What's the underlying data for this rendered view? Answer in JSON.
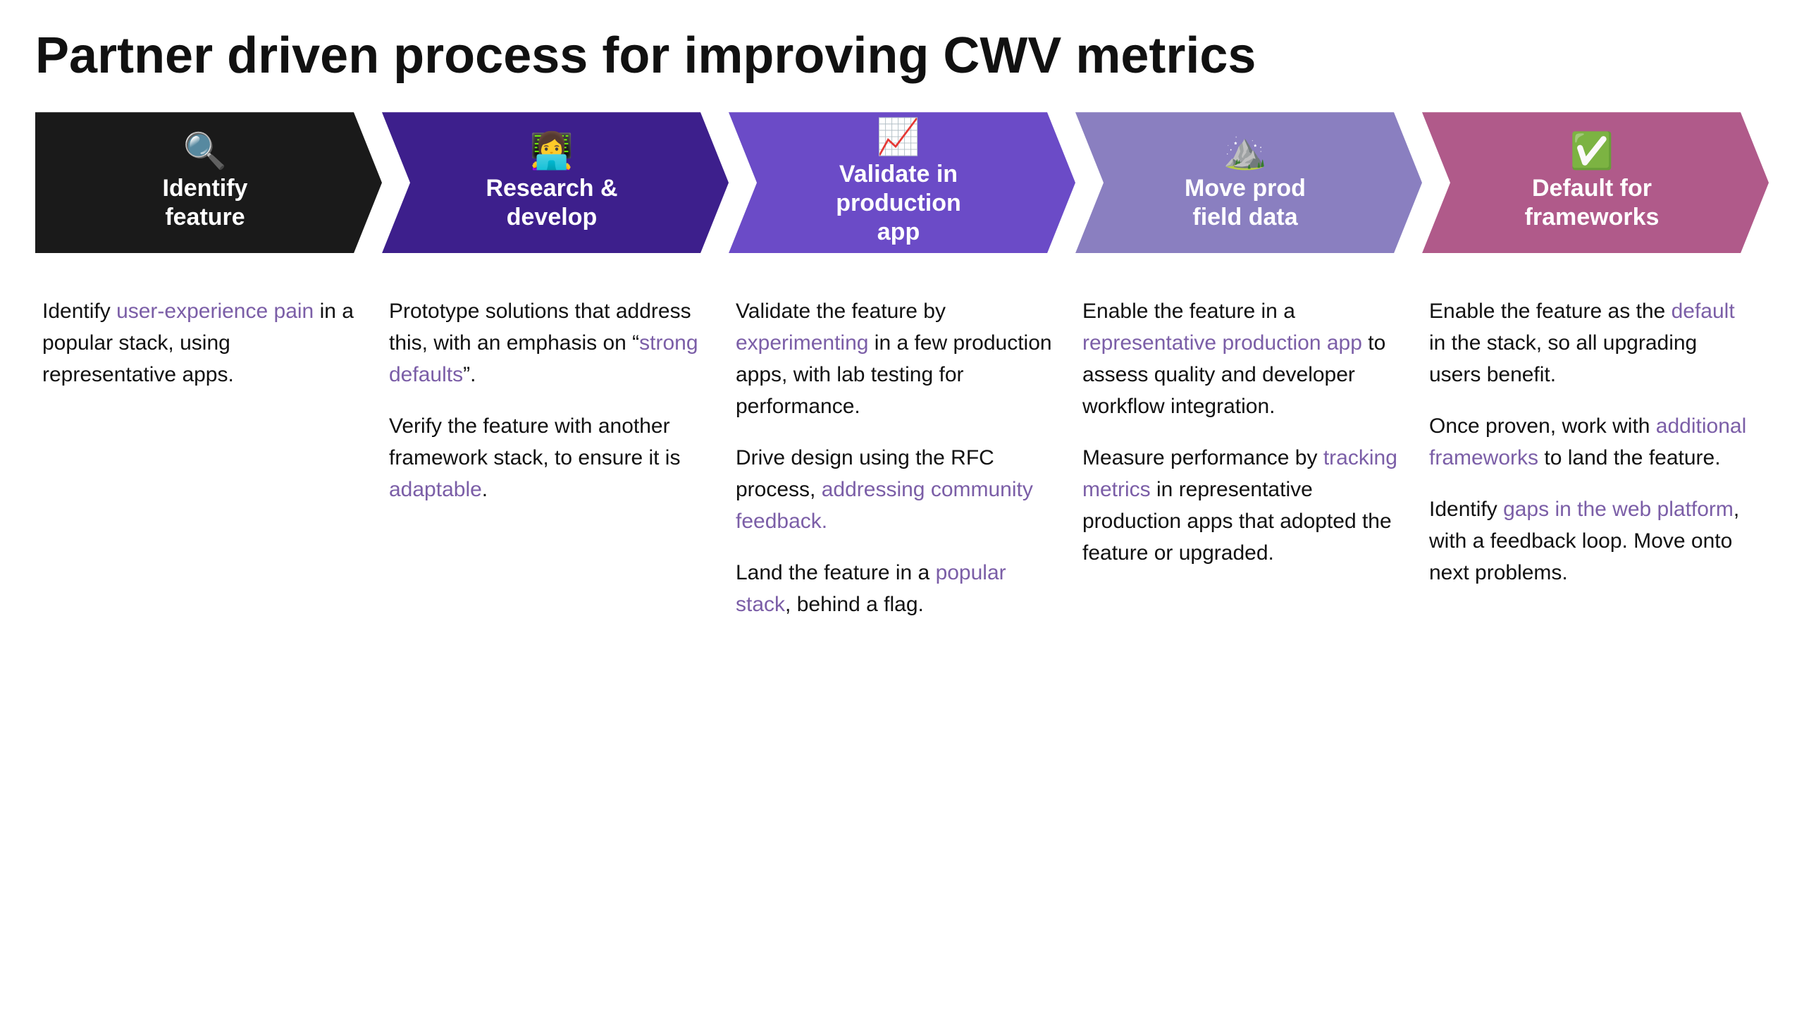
{
  "page": {
    "title": "Partner driven process for improving CWV metrics"
  },
  "arrows": [
    {
      "id": "identify",
      "icon": "🔍",
      "label": "Identify\nfeature",
      "color": "#1a1a1a",
      "colorClass": "arrow-1"
    },
    {
      "id": "research",
      "icon": "👩‍💻",
      "label": "Research &\ndevelop",
      "color": "#3d1f8c",
      "colorClass": "arrow-2"
    },
    {
      "id": "validate",
      "icon": "📈",
      "label": "Validate in\nproduction\napp",
      "color": "#6b4bc7",
      "colorClass": "arrow-3"
    },
    {
      "id": "move",
      "icon": "⛰️",
      "label": "Move prod\nfield data",
      "color": "#8a7fc0",
      "colorClass": "arrow-4"
    },
    {
      "id": "default",
      "icon": "✅",
      "label": "Default for\nframeworks",
      "color": "#b05a8a",
      "colorClass": "arrow-5"
    }
  ],
  "columns": [
    {
      "id": "identify-content",
      "paragraphs": [
        {
          "parts": [
            {
              "text": "Identify ",
              "type": "plain"
            },
            {
              "text": "user-experience pain",
              "type": "link"
            },
            {
              "text": " in a popular stack, using representative apps.",
              "type": "plain"
            }
          ]
        }
      ]
    },
    {
      "id": "research-content",
      "paragraphs": [
        {
          "parts": [
            {
              "text": "Prototype solutions that address this, with an emphasis on “",
              "type": "plain"
            },
            {
              "text": "strong defaults",
              "type": "link"
            },
            {
              "text": "”.",
              "type": "plain"
            }
          ]
        },
        {
          "parts": [
            {
              "text": "Verify the feature with another framework stack, to ensure it is ",
              "type": "plain"
            },
            {
              "text": "adaptable",
              "type": "link"
            },
            {
              "text": ".",
              "type": "plain"
            }
          ]
        }
      ]
    },
    {
      "id": "validate-content",
      "paragraphs": [
        {
          "parts": [
            {
              "text": "Validate the feature by ",
              "type": "plain"
            },
            {
              "text": "experimenting",
              "type": "link"
            },
            {
              "text": " in a few production apps, with lab testing for performance.",
              "type": "plain"
            }
          ]
        },
        {
          "parts": [
            {
              "text": "Drive design using the RFC process, ",
              "type": "plain"
            },
            {
              "text": "addressing community feedback.",
              "type": "link"
            }
          ]
        },
        {
          "parts": [
            {
              "text": "Land the feature in a ",
              "type": "plain"
            },
            {
              "text": "popular stack",
              "type": "link"
            },
            {
              "text": ", behind a flag.",
              "type": "plain"
            }
          ]
        }
      ]
    },
    {
      "id": "move-content",
      "paragraphs": [
        {
          "parts": [
            {
              "text": "Enable the feature in a ",
              "type": "plain"
            },
            {
              "text": "representative production app",
              "type": "link"
            },
            {
              "text": " to assess quality and developer workflow integration.",
              "type": "plain"
            }
          ]
        },
        {
          "parts": [
            {
              "text": "Measure performance by ",
              "type": "plain"
            },
            {
              "text": "tracking metrics",
              "type": "link"
            },
            {
              "text": " in representative production apps that adopted the feature or upgraded.",
              "type": "plain"
            }
          ]
        }
      ]
    },
    {
      "id": "default-content",
      "paragraphs": [
        {
          "parts": [
            {
              "text": "Enable the feature as the ",
              "type": "plain"
            },
            {
              "text": "default",
              "type": "link"
            },
            {
              "text": " in the stack, so all upgrading users benefit.",
              "type": "plain"
            }
          ]
        },
        {
          "parts": [
            {
              "text": "Once proven, work with ",
              "type": "plain"
            },
            {
              "text": "additional frameworks",
              "type": "link"
            },
            {
              "text": " to land the feature.",
              "type": "plain"
            }
          ]
        },
        {
          "parts": [
            {
              "text": "Identify ",
              "type": "plain"
            },
            {
              "text": "gaps in the web platform",
              "type": "link"
            },
            {
              "text": ", with a feedback loop. Move onto next problems.",
              "type": "plain"
            }
          ]
        }
      ]
    }
  ],
  "colors": {
    "link": "#7b5ea7",
    "text": "#111111"
  }
}
